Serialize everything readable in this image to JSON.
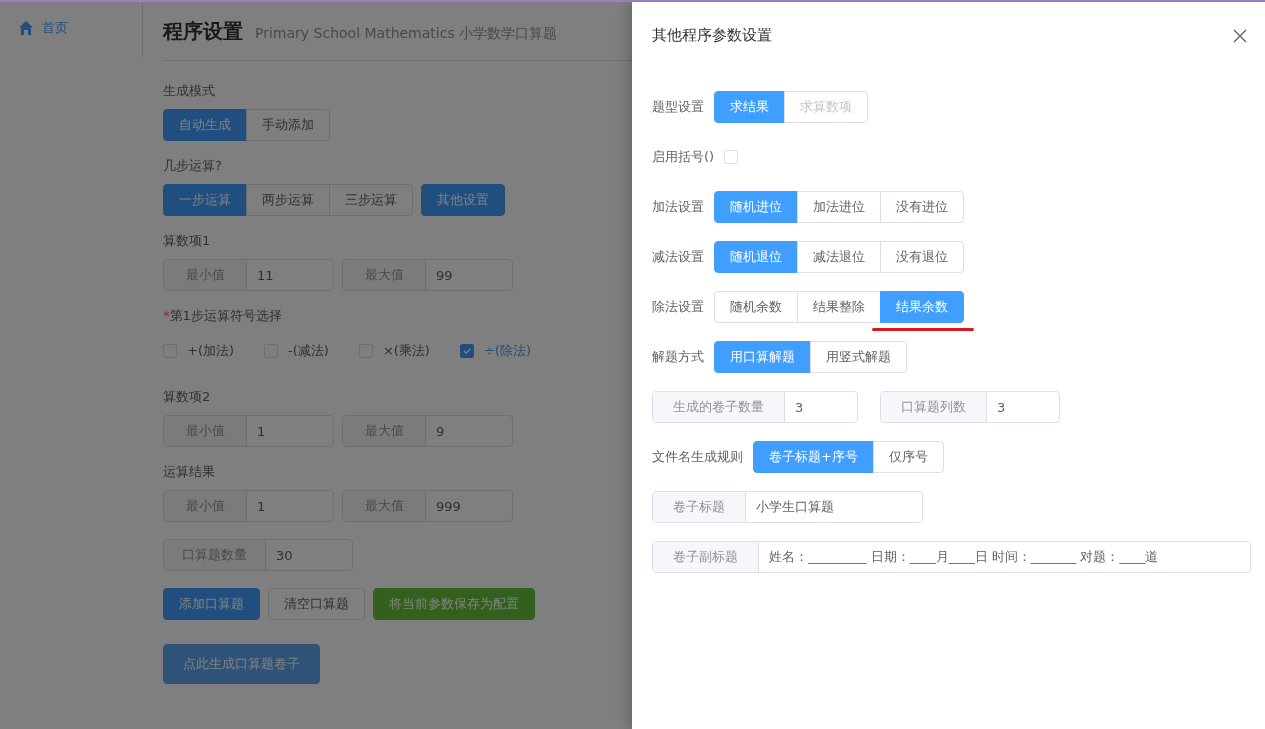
{
  "sidebar": {
    "items": [
      {
        "label": "首页",
        "selected": true
      }
    ]
  },
  "page": {
    "title": "程序设置",
    "subtitle": "Primary School Mathematics 小学数学口算题",
    "sections": [
      {
        "kind": "buttons",
        "label": "生成模式",
        "options": [
          {
            "label": "自动生成",
            "selected": true
          },
          {
            "label": "手动添加",
            "selected": false
          }
        ]
      },
      {
        "kind": "buttons",
        "label": "几步运算?",
        "options": [
          {
            "label": "一步运算",
            "selected": true
          },
          {
            "label": "两步运算",
            "selected": false
          },
          {
            "label": "三步运算",
            "selected": false
          }
        ],
        "extra_button": "其他设置"
      },
      {
        "kind": "fields",
        "label": "算数项1",
        "fields": [
          {
            "label": "最小值",
            "value": "11"
          },
          {
            "label": "最大值",
            "value": "99"
          }
        ]
      },
      {
        "kind": "checks",
        "label": "第1步运算符号选择",
        "required_mark": "*",
        "options": [
          {
            "label": "+(加法)",
            "checked": false
          },
          {
            "label": "-(减法)",
            "checked": false
          },
          {
            "label": "×(乘法)",
            "checked": false
          },
          {
            "label": "÷(除法)",
            "checked": true
          }
        ]
      },
      {
        "kind": "fields",
        "label": "算数项2",
        "fields": [
          {
            "label": "最小值",
            "value": "1"
          },
          {
            "label": "最大值",
            "value": "9"
          }
        ]
      },
      {
        "kind": "fields",
        "label": "运算结果",
        "fields": [
          {
            "label": "最小值",
            "value": "1"
          },
          {
            "label": "最大值",
            "value": "999"
          }
        ]
      },
      {
        "kind": "fields",
        "fields": [
          {
            "label": "口算题数量",
            "value": "30"
          }
        ]
      },
      {
        "kind": "actions",
        "buttons": [
          {
            "label": "添加口算题",
            "kind": "primary",
            "disabled": false
          },
          {
            "label": "清空口算题",
            "kind": "default",
            "disabled": false
          },
          {
            "label": "将当前参数保存为配置",
            "kind": "success",
            "disabled": false
          }
        ]
      },
      {
        "kind": "actions",
        "buttons": [
          {
            "label": "点此生成口算题卷子",
            "kind": "primary",
            "disabled": true
          }
        ]
      }
    ]
  },
  "drawer": {
    "title": "其他程序参数设置",
    "rows": [
      {
        "kind": "buttons",
        "label": "题型设置",
        "options": [
          {
            "label": "求结果",
            "selected": true,
            "disabled": false
          },
          {
            "label": "求算数项",
            "selected": false,
            "disabled": true
          }
        ]
      },
      {
        "kind": "checkbox",
        "label": "启用括号()",
        "checked": false
      },
      {
        "kind": "buttons",
        "label": "加法设置",
        "options": [
          {
            "label": "随机进位",
            "selected": true
          },
          {
            "label": "加法进位",
            "selected": false
          },
          {
            "label": "没有进位",
            "selected": false
          }
        ]
      },
      {
        "kind": "buttons",
        "label": "减法设置",
        "options": [
          {
            "label": "随机退位",
            "selected": true
          },
          {
            "label": "减法退位",
            "selected": false
          },
          {
            "label": "没有退位",
            "selected": false
          }
        ]
      },
      {
        "kind": "buttons",
        "label": "除法设置",
        "options": [
          {
            "label": "随机余数",
            "selected": false,
            "underlined": false
          },
          {
            "label": "结果整除",
            "selected": false,
            "underlined": false
          },
          {
            "label": "结果余数",
            "selected": true,
            "underlined": true
          }
        ]
      },
      {
        "kind": "buttons",
        "label": "解题方式",
        "options": [
          {
            "label": "用口算解题",
            "selected": true
          },
          {
            "label": "用竖式解题",
            "selected": false
          }
        ]
      },
      {
        "kind": "fields",
        "fields": [
          {
            "label": "生成的卷子数量",
            "value": "3"
          },
          {
            "label": "口算题列数",
            "value": "3"
          }
        ]
      },
      {
        "kind": "buttons",
        "label": "文件名生成规则",
        "options": [
          {
            "label": "卷子标题+序号",
            "selected": true
          },
          {
            "label": "仅序号",
            "selected": false
          }
        ]
      },
      {
        "kind": "text_field",
        "fields": [
          {
            "label": "卷子标题",
            "value": "小学生口算题"
          }
        ]
      },
      {
        "kind": "wide_field",
        "fields": [
          {
            "label": "卷子副标题",
            "value": "姓名：_________ 日期：____月____日 时间：_______ 对题：____道"
          }
        ]
      }
    ]
  }
}
